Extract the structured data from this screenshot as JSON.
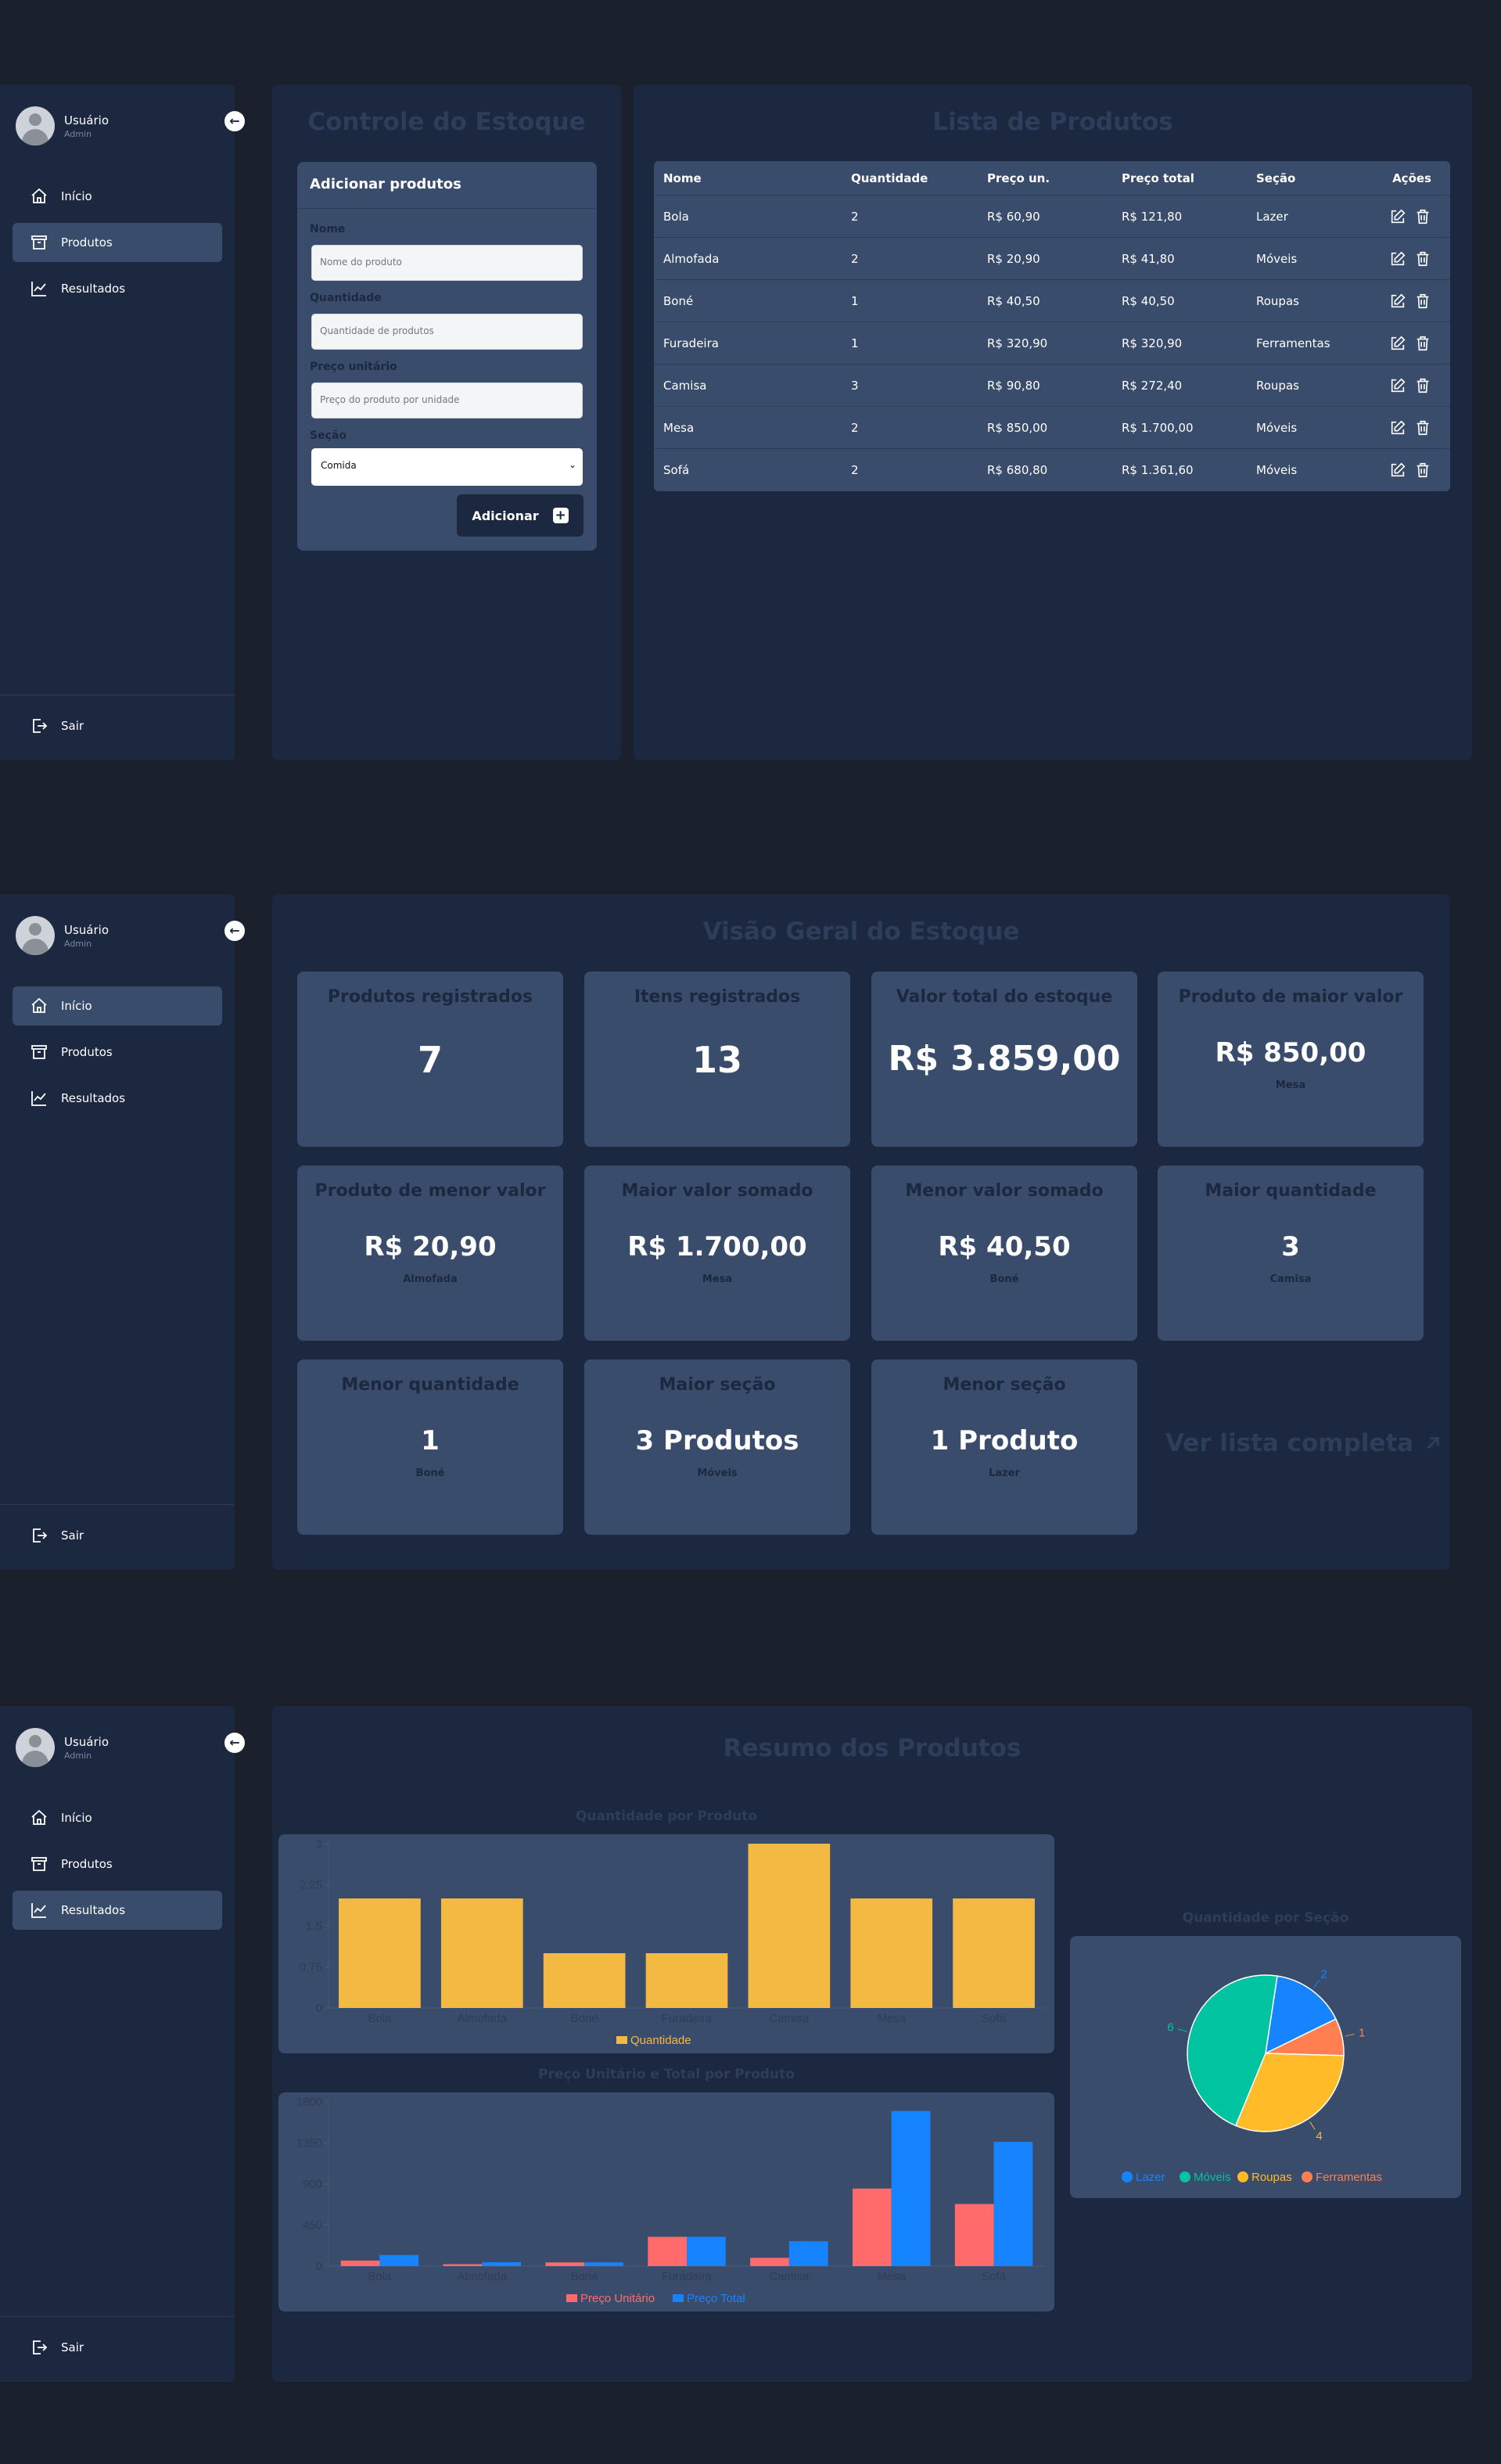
{
  "user": {
    "name": "Usuário",
    "role": "Admin"
  },
  "nav": {
    "home": "Início",
    "products": "Produtos",
    "results": "Resultados",
    "logout": "Sair"
  },
  "icons": {
    "collapse": "arrow-left-icon",
    "home": "home-icon",
    "products": "archive-icon",
    "results": "line-chart-icon",
    "logout": "logout-icon",
    "edit": "edit-icon",
    "delete": "trash-icon",
    "plus": "plus-icon",
    "external": "arrow-up-right-icon"
  },
  "colors": {
    "background": "#1a212d",
    "panel": "#1c2840",
    "card": "#3a4c6b",
    "bar_yellow": "#f4b942",
    "bar_red": "#ff6b6b",
    "bar_blue": "#1784ff",
    "pie_green": "#00c4a0"
  },
  "stock": {
    "title": "Controle do Estoque",
    "form": {
      "title": "Adicionar produtos",
      "name_label": "Nome",
      "name_placeholder": "Nome do produto",
      "qty_label": "Quantidade",
      "qty_placeholder": "Quantidade de produtos",
      "price_label": "Preço unitário",
      "price_placeholder": "Preço do produto por unidade",
      "section_label": "Seção",
      "section_value": "Comida",
      "submit": "Adicionar"
    }
  },
  "product_list": {
    "title": "Lista de Produtos",
    "headers": [
      "Nome",
      "Quantidade",
      "Preço un.",
      "Preço total",
      "Seção",
      "Ações"
    ],
    "rows": [
      [
        "Bola",
        "2",
        "R$ 60,90",
        "R$ 121,80",
        "Lazer"
      ],
      [
        "Almofada",
        "2",
        "R$ 20,90",
        "R$ 41,80",
        "Móveis"
      ],
      [
        "Boné",
        "1",
        "R$ 40,50",
        "R$ 40,50",
        "Roupas"
      ],
      [
        "Furadeira",
        "1",
        "R$ 320,90",
        "R$ 320,90",
        "Ferramentas"
      ],
      [
        "Camisa",
        "3",
        "R$ 90,80",
        "R$ 272,40",
        "Roupas"
      ],
      [
        "Mesa",
        "2",
        "R$ 850,00",
        "R$ 1.700,00",
        "Móveis"
      ],
      [
        "Sofá",
        "2",
        "R$ 680,80",
        "R$ 1.361,60",
        "Móveis"
      ]
    ]
  },
  "overview": {
    "title": "Visão Geral do Estoque",
    "cards": [
      {
        "title": "Produtos registrados",
        "value": "7",
        "sub": ""
      },
      {
        "title": "Itens registrados",
        "value": "13",
        "sub": ""
      },
      {
        "title": "Valor total do estoque",
        "value": "R$ 3.859,00",
        "sub": ""
      },
      {
        "title": "Produto de maior valor",
        "value": "R$ 850,00",
        "sub": "Mesa"
      },
      {
        "title": "Produto de menor valor",
        "value": "R$ 20,90",
        "sub": "Almofada"
      },
      {
        "title": "Maior valor somado",
        "value": "R$ 1.700,00",
        "sub": "Mesa"
      },
      {
        "title": "Menor valor somado",
        "value": "R$ 40,50",
        "sub": "Boné"
      },
      {
        "title": "Maior quantidade",
        "value": "3",
        "sub": "Camisa"
      },
      {
        "title": "Menor quantidade",
        "value": "1",
        "sub": "Boné"
      },
      {
        "title": "Maior seção",
        "value": "3 Produtos",
        "sub": "Móveis"
      },
      {
        "title": "Menor seção",
        "value": "1 Produto",
        "sub": "Lazer"
      }
    ],
    "see_all": "Ver lista completa"
  },
  "summary": {
    "title": "Resumo dos Produtos"
  },
  "chart_data": [
    {
      "type": "bar",
      "title": "Quantidade por Produto",
      "categories": [
        "Bola",
        "Almofada",
        "Boné",
        "Furadeira",
        "Camisa",
        "Mesa",
        "Sofá"
      ],
      "series": [
        {
          "name": "Quantidade",
          "values": [
            2,
            2,
            1,
            1,
            3,
            2,
            2
          ],
          "color": "#f4b942"
        }
      ],
      "yticks": [
        "0",
        "0.75",
        "1.5",
        "2.25",
        "3"
      ],
      "ylim": [
        0,
        3
      ],
      "legend": "bottom"
    },
    {
      "type": "bar",
      "title": "Preço Unitário e Total por Produto",
      "categories": [
        "Bola",
        "Almofada",
        "Boné",
        "Furadeira",
        "Camisa",
        "Mesa",
        "Sofá"
      ],
      "series": [
        {
          "name": "Preço Unitário",
          "values": [
            60.9,
            20.9,
            40.5,
            320.9,
            90.8,
            850,
            680.8
          ],
          "color": "#ff6b6b"
        },
        {
          "name": "Preço Total",
          "values": [
            121.8,
            41.8,
            40.5,
            320.9,
            272.4,
            1700,
            1361.6
          ],
          "color": "#1784ff"
        }
      ],
      "yticks": [
        "0",
        "450",
        "900",
        "1350",
        "1800"
      ],
      "ylim": [
        0,
        1800
      ],
      "legend": "bottom"
    },
    {
      "type": "pie",
      "title": "Quantidade por Seção",
      "slices": [
        {
          "name": "Lazer",
          "value": 2,
          "label": "2",
          "color": "#1784ff"
        },
        {
          "name": "Ferramentas",
          "value": 1,
          "label": "1",
          "color": "#ff7f50"
        },
        {
          "name": "Roupas",
          "value": 4,
          "label": "4",
          "color": "#ffbb28"
        },
        {
          "name": "Móveis",
          "value": 6,
          "label": "6",
          "color": "#00c4a0"
        }
      ],
      "legend_order": [
        "Lazer",
        "Móveis",
        "Roupas",
        "Ferramentas"
      ],
      "legend": "bottom"
    }
  ]
}
